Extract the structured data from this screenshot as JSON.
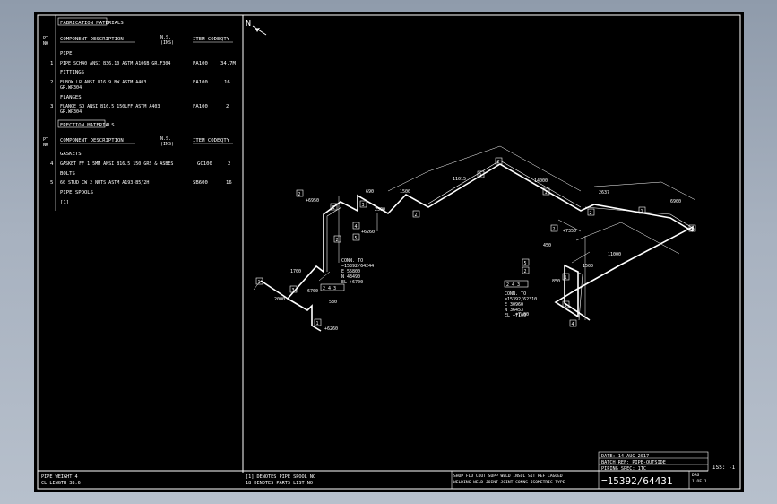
{
  "materials": {
    "fabrication_title": "FABRICATION MATERIALS",
    "pt_no": [
      "PT",
      "NO"
    ],
    "col_desc": "COMPONENT DESCRIPTION",
    "col_ns": [
      "N.S.",
      "(INS)"
    ],
    "col_item": "ITEM CODE",
    "col_qty": "QTY",
    "pipe_head": "PIPE",
    "pipe_row": {
      "pt": "1",
      "desc": "PIPE SCH40 ANSI B36.10 ASTM A106B GR.F304",
      "ns": "",
      "code": "PA100",
      "qty": "34.7M"
    },
    "fittings_head": "FITTINGS",
    "fitting_row": {
      "pt": "2",
      "desc": "ELBOW LR ANSI B16.9 BW ASTM A403",
      "desc2": "GR.WP304",
      "ns": "",
      "code": "EA100",
      "qty": "16"
    },
    "flanges_head": "FLANGES",
    "flange_row": {
      "pt": "3",
      "desc": "FLANGE SO ANSI B16.5 150LFF ASTM A403",
      "desc2": "GR.WP304",
      "ns": "",
      "code": "FA100",
      "qty": "2"
    },
    "erection_title": "ERECTION MATERIALS",
    "gaskets_head": "GASKETS",
    "gasket_row": {
      "pt": "4",
      "desc": "GASKET FF 1.5MM ANSI B16.5 150 GRS & ASBES",
      "code": "GC100",
      "qty": "2"
    },
    "bolts_head": "BOLTS",
    "bolt_row": {
      "pt": "5",
      "desc": "60 STUD CW 2 NUTS ASTM A193-B5/2H",
      "code": "SB600",
      "qty": "16"
    },
    "spools_head": "PIPE SPOOLS",
    "spools_val": "[1]"
  },
  "footer": {
    "weight_line": "PIPE WEIGHT  4",
    "length_line": "CL LENGTH  38.6",
    "note1": "[1] DENOTES PIPE SPOOL NO",
    "note2": "18 DENOTES PARTS LIST NO",
    "cols_row1": "SHOP FLD  COUT  SUPP  WELD  INSUL  SIT  REF  LAGGED",
    "cols_row2": "WELDING  WELD  JOINT  JOINT  CONNS  ISOMETRIC  TYPE",
    "date_line": "DATE: 14 AUG 2017",
    "batch_line": "BATCH REF: PIPE-OUTSIDE",
    "piping_line": "PIPING SPEC: 1TC",
    "drawing_no": "=15392/64431",
    "drg_label": "DRG",
    "drg_value": "1 OF 1",
    "iss": "ISS: -1"
  },
  "north_label": "N",
  "drawing": {
    "dims": [
      "+6950",
      "+6260",
      "690",
      "2500",
      "1500",
      "11015",
      "14000",
      "2637",
      "6900",
      "+7350",
      "11000",
      "450",
      "1500",
      "850",
      "1700",
      "+6700",
      "+6260",
      "+7100",
      "2000",
      "530"
    ],
    "conn1": [
      "CONN. TO",
      "=15392/64244",
      "E 55800",
      "N 43490",
      "EL +6700"
    ],
    "conn2": [
      "CONN. TO",
      "=15392/62310",
      "E 30960",
      "N 36453",
      "EL +7100"
    ],
    "tags": [
      "2",
      "1",
      "3",
      "4",
      "5",
      "2",
      "1",
      "2",
      "1",
      "2",
      "1",
      "2",
      "1",
      "3",
      "1",
      "2",
      "5",
      "2",
      "1",
      "3",
      "4",
      "2"
    ],
    "flange_tags": [
      "2 4 3",
      "2 4 3"
    ]
  }
}
